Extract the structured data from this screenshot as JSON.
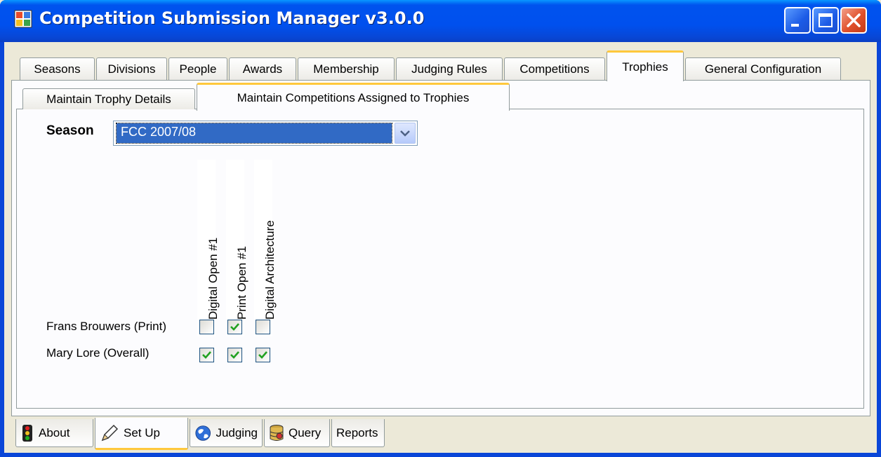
{
  "window": {
    "title": "Competition Submission Manager v3.0.0",
    "icon": "app-grid-icon",
    "controls": [
      "minimize-icon",
      "maximize-icon",
      "close-icon"
    ]
  },
  "top_tabs": [
    "Seasons",
    "Divisions",
    "People",
    "Awards",
    "Membership",
    "Judging Rules",
    "Competitions",
    "Trophies",
    "General Configuration"
  ],
  "top_tabs_selected": "Trophies",
  "sub_tabs": [
    "Maintain Trophy Details",
    "Maintain Competitions Assigned to Trophies"
  ],
  "sub_tabs_selected": "Maintain Competitions Assigned to Trophies",
  "season": {
    "label": "Season",
    "value": "FCC 2007/08"
  },
  "grid": {
    "columns": [
      "Digital Open #1",
      "Print Open #1",
      "Digital Architecture"
    ],
    "rows": [
      {
        "label": "Frans Brouwers (Print)",
        "checks": [
          false,
          true,
          false
        ]
      },
      {
        "label": "Mary Lore (Overall)",
        "checks": [
          true,
          true,
          true
        ]
      }
    ]
  },
  "bottom_tabs": [
    {
      "label": "About",
      "icon": "traffic-light-icon"
    },
    {
      "label": "Set Up",
      "icon": "pencil-icon"
    },
    {
      "label": "Judging",
      "icon": "globe-icon"
    },
    {
      "label": "Query",
      "icon": "database-icon"
    },
    {
      "label": "Reports",
      "icon": ""
    }
  ],
  "bottom_tabs_selected": "Set Up",
  "colors": {
    "titlebar": "#0054e3",
    "tab_highlight": "#ffc83c",
    "selection": "#316ac5",
    "check": "#21a121"
  }
}
